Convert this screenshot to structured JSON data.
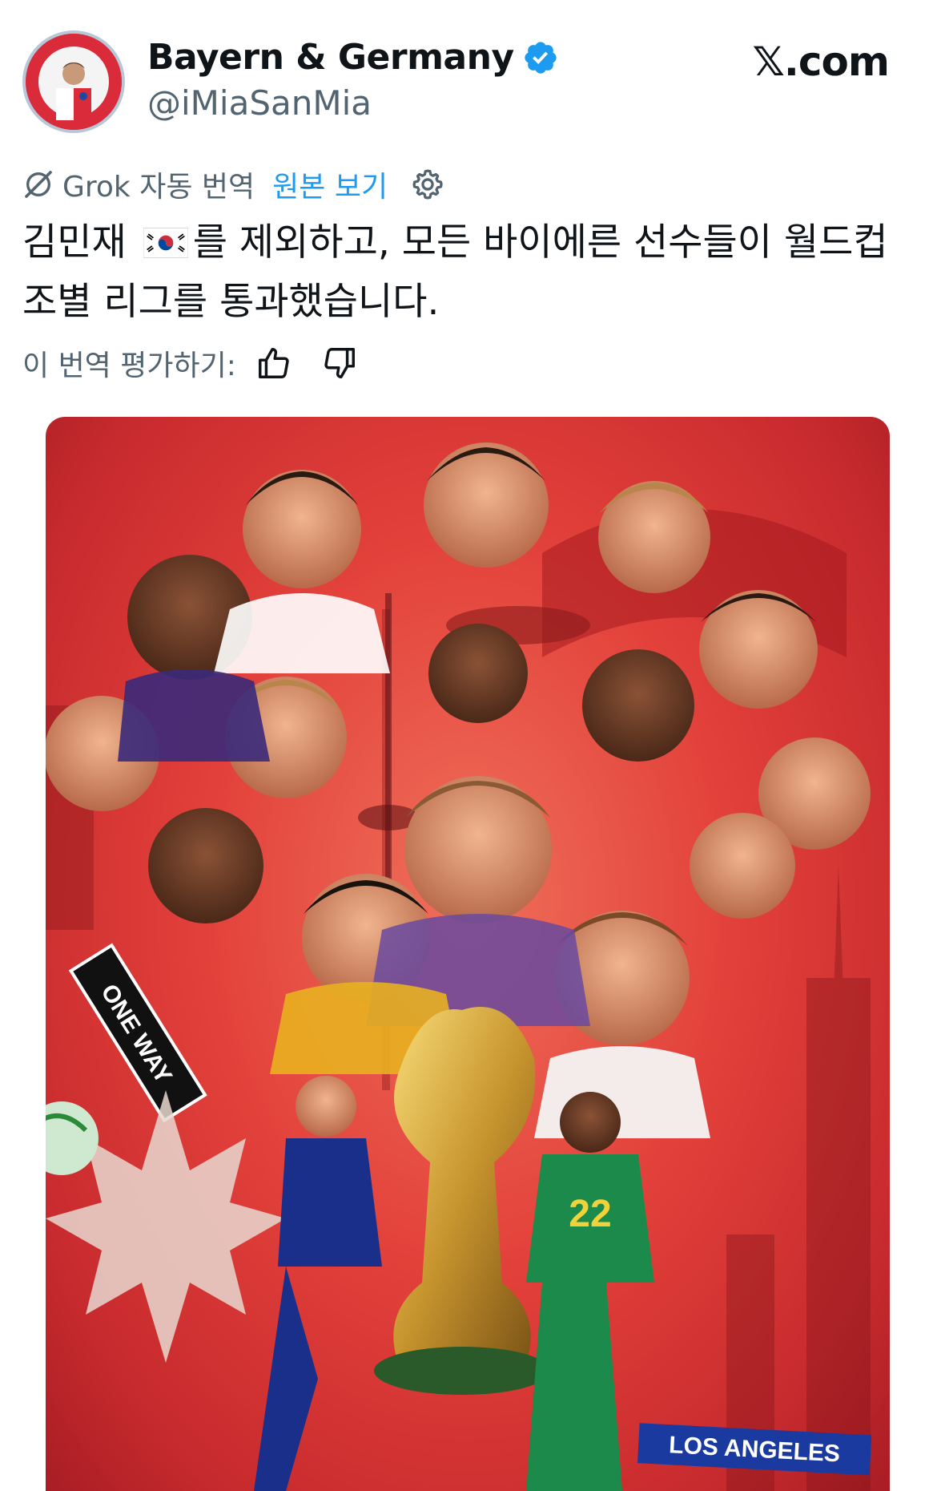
{
  "account": {
    "display_name": "Bayern & Germany",
    "handle": "@iMiaSanMia",
    "verified": true,
    "avatar_text": "iMiaSanMia"
  },
  "brand": "𝕏.com",
  "translation": {
    "label": "Grok 자동 번역",
    "view_original": "원본 보기",
    "rate_label": "이 번역 평가하기:"
  },
  "tweet": {
    "text_before_flag": "김민재",
    "flag": "🇰🇷",
    "text_after_flag": "를 제외하고, 모든 바이에른 선수들이 월드컵 조별 리그를 통과했습니다."
  },
  "media": {
    "description_icon": "image",
    "sign_text": "ONE WAY",
    "banner_text": "LOS ANGELES",
    "jersey_number": "22",
    "background_color": "#e2403a"
  },
  "colors": {
    "accent": "#1d9bf0",
    "secondary_text": "#536471",
    "primary_text": "#0f1419"
  }
}
